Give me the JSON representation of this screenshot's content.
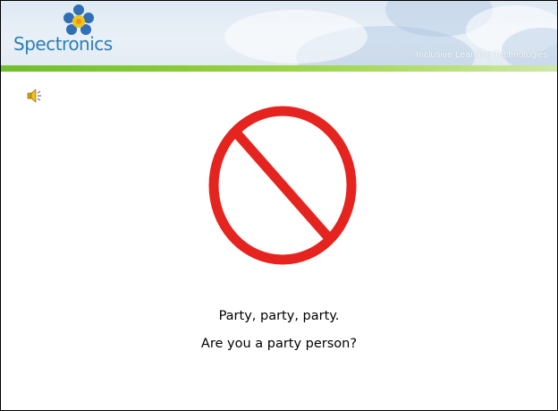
{
  "header": {
    "logo_text": "Spectronics",
    "tagline": "Inclusive Learning Technologies"
  },
  "slide": {
    "audio_icon": "speaker-icon",
    "main_image": "prohibition-sign-icon",
    "caption_line1": "Party, party, party.",
    "caption_line2": "Are you a party person?"
  },
  "colors": {
    "logo_blue": "#2b7fb8",
    "accent_green": "#8ccc3a",
    "prohibition_red": "#e52420"
  }
}
